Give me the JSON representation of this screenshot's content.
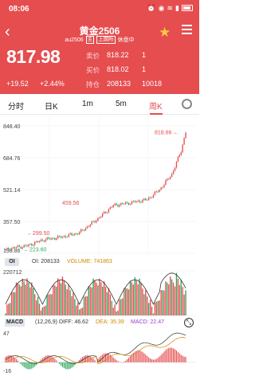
{
  "status": {
    "time": "08:06"
  },
  "header": {
    "title": "黄金2506",
    "code": "au2506",
    "tag_main": "主",
    "tag_exchange": "上期所",
    "session": "休盘中",
    "last_price": "817.98",
    "change": "+19.52",
    "change_pct": "+2.44%",
    "ask_label": "卖价",
    "ask_price": "818.22",
    "ask_qty": "1",
    "bid_label": "买价",
    "bid_price": "818.02",
    "bid_qty": "1",
    "oi_label": "持仓",
    "open_interest": "208133",
    "volume": "10018"
  },
  "tabs": [
    {
      "label": "分时"
    },
    {
      "label": "日K"
    },
    {
      "label": "1m"
    },
    {
      "label": "5m"
    },
    {
      "label": "周K"
    }
  ],
  "chart_data": [
    {
      "type": "candlestick",
      "title": "",
      "y_ticks": [
        "848.40",
        "684.76",
        "521.14",
        "357.50",
        "193.86"
      ],
      "ylim": [
        193.86,
        848.4
      ],
      "annotations": [
        "818.66",
        "459.56",
        "299.50",
        "223.60"
      ]
    },
    {
      "type": "bar",
      "indicator_button": "OI",
      "oi_label": "OI: 208133",
      "volume_label": "VOLUME: 741863",
      "y_top": "220712",
      "y_bottom": "0"
    },
    {
      "type": "bar",
      "name": "MACD",
      "params": "(12,26,9)",
      "diff_label": "DIFF: 46.62",
      "dea_label": "DEA: 35.39",
      "macd_label": "MACD: 22.47",
      "y_top": "47",
      "y_bottom": "-16"
    }
  ],
  "colors": {
    "up": "#e54d4f",
    "down": "#2aa85a",
    "accent": "#e54d4f",
    "oi": "#333333",
    "volume": "#d08a00"
  },
  "icons": [
    "back-icon",
    "star-icon",
    "menu-icon",
    "settings-icon",
    "expand-icon"
  ]
}
